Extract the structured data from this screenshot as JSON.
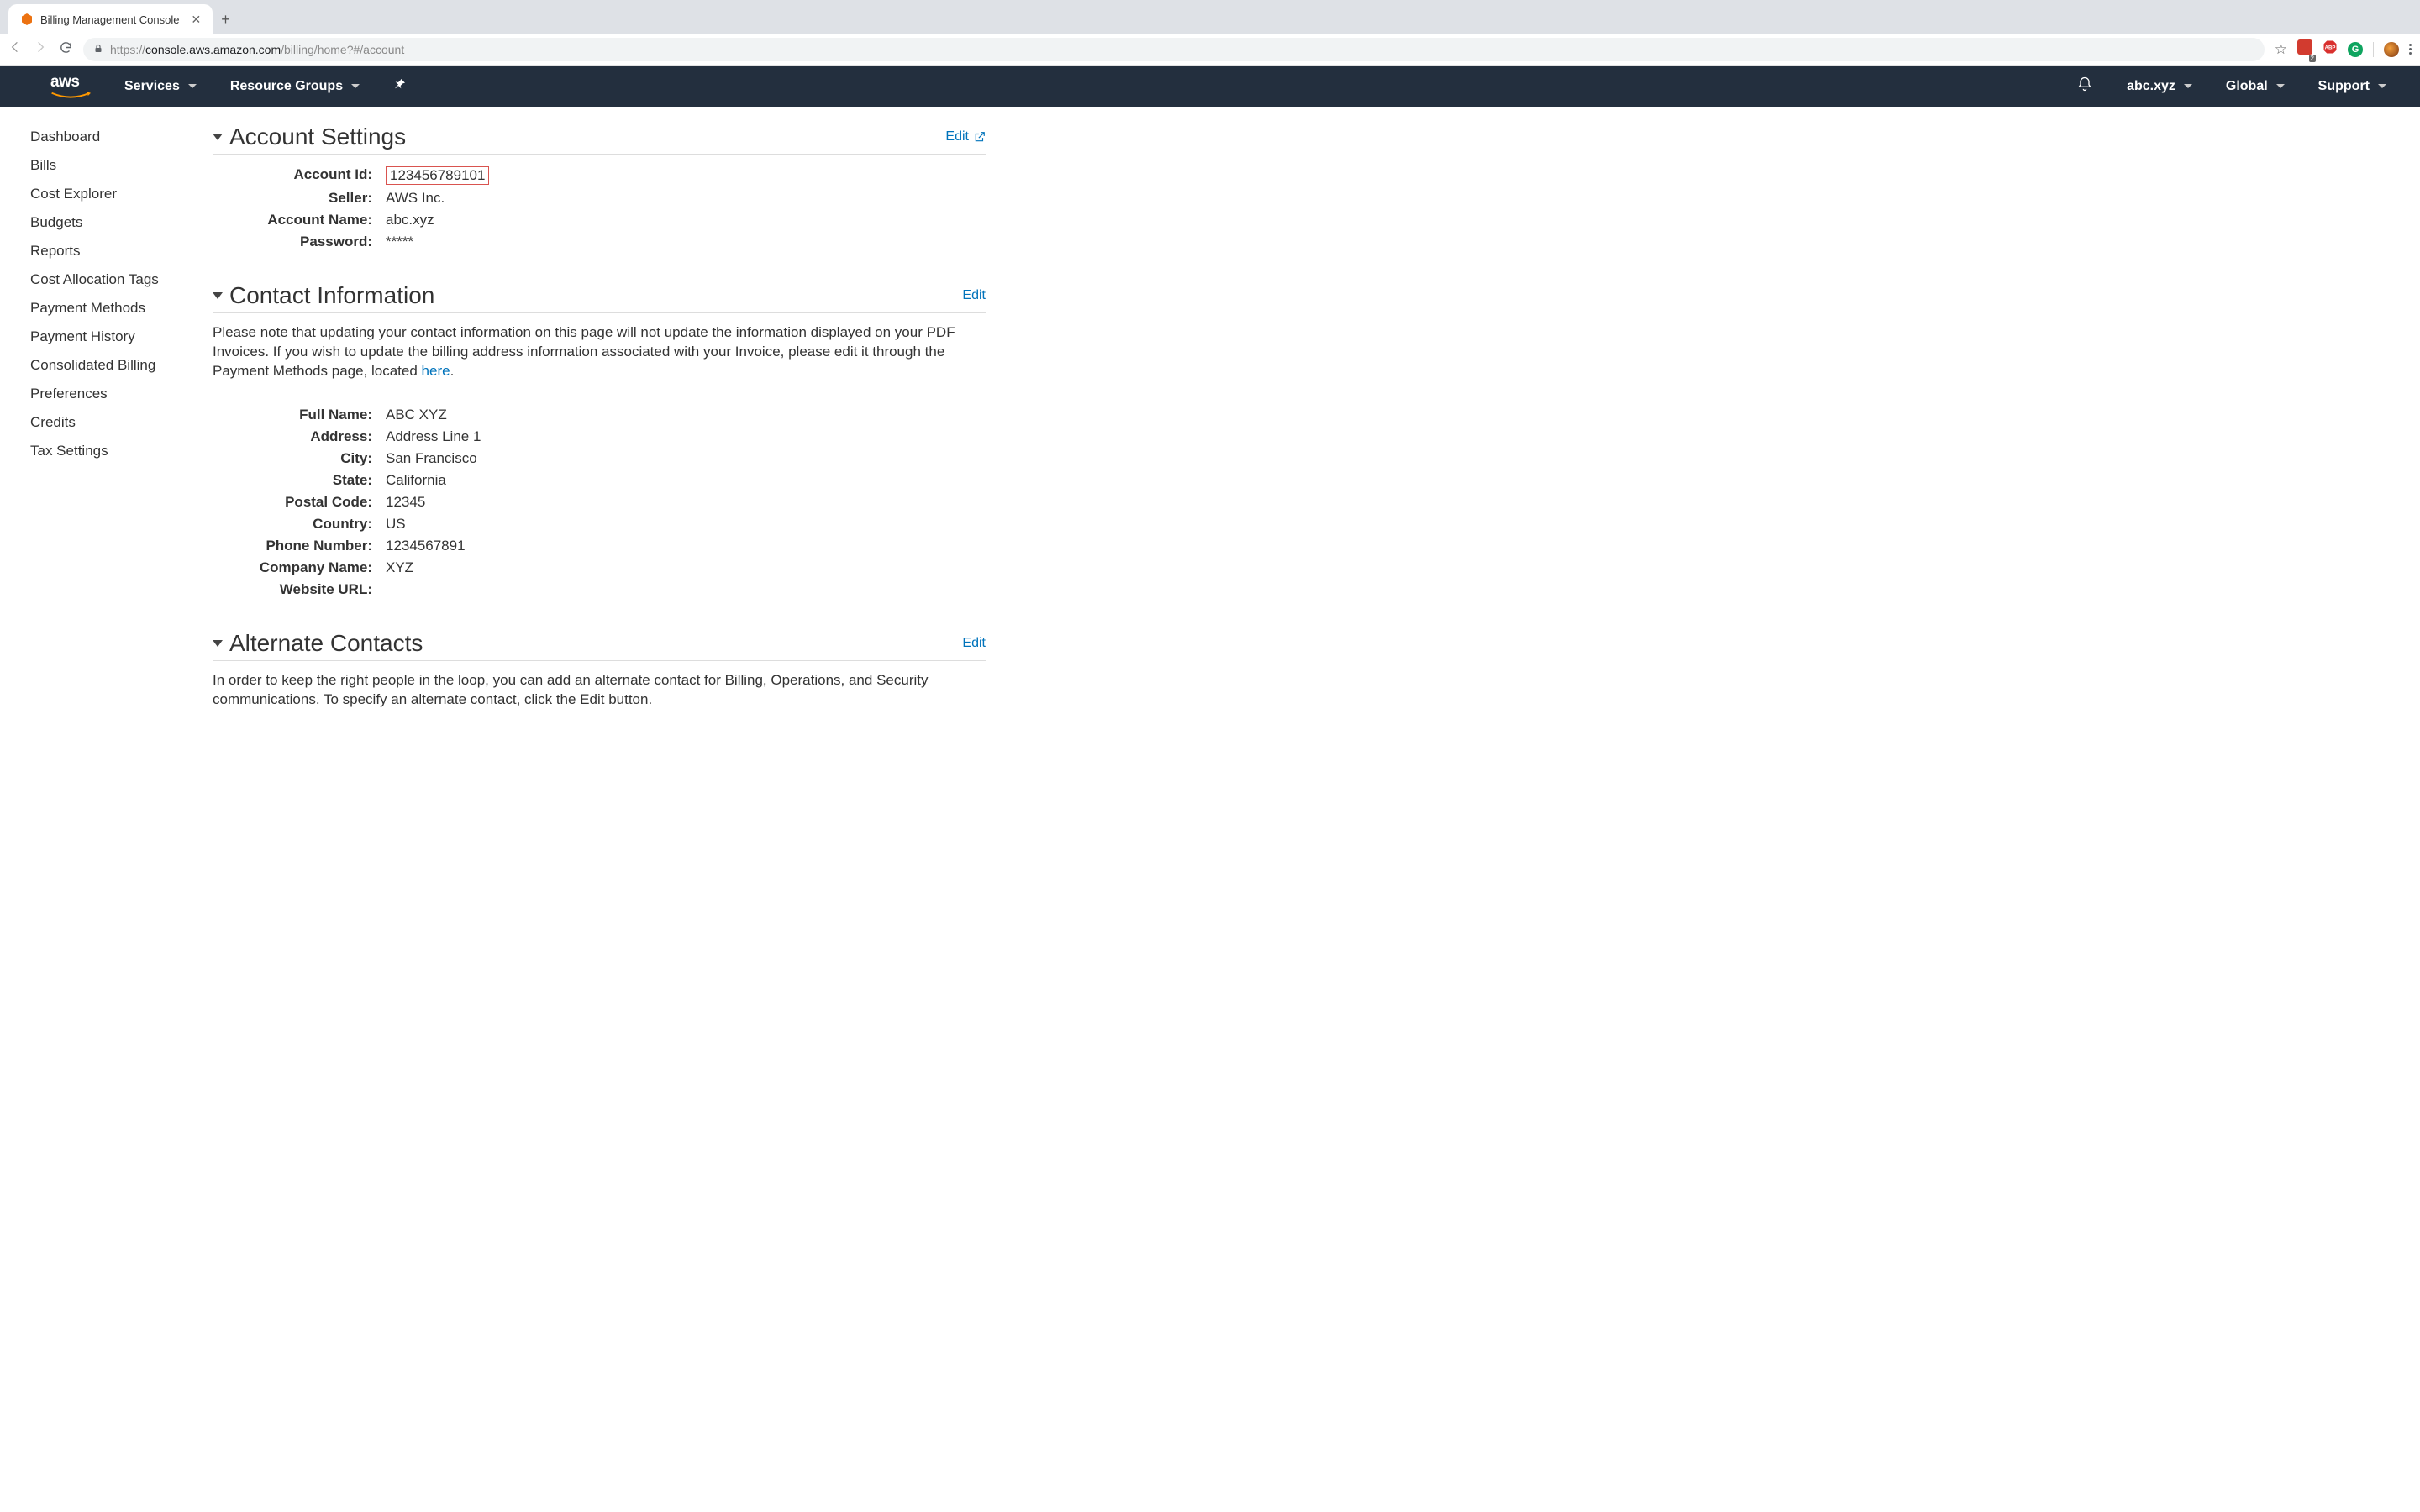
{
  "browser": {
    "tab_title": "Billing Management Console",
    "url_scheme": "https://",
    "url_host": "console.aws.amazon.com",
    "url_path": "/billing/home?#/account",
    "ext_badge1": "",
    "ext_badge1_count": "2",
    "ext_badge2": "ABP",
    "ext_badge3": "G"
  },
  "header": {
    "logo": "aws",
    "services": "Services",
    "resource_groups": "Resource Groups",
    "user": "abc.xyz",
    "region": "Global",
    "support": "Support"
  },
  "sidebar": {
    "items": [
      "Dashboard",
      "Bills",
      "Cost Explorer",
      "Budgets",
      "Reports",
      "Cost Allocation Tags",
      "Payment Methods",
      "Payment History",
      "Consolidated Billing",
      "Preferences",
      "Credits",
      "Tax Settings"
    ]
  },
  "sections": {
    "account": {
      "title": "Account Settings",
      "edit": "Edit",
      "fields": {
        "account_id_label": "Account Id:",
        "account_id_value": "123456789101",
        "seller_label": "Seller:",
        "seller_value": "AWS Inc.",
        "account_name_label": "Account Name:",
        "account_name_value": "abc.xyz",
        "password_label": "Password:",
        "password_value": "*****"
      }
    },
    "contact": {
      "title": "Contact Information",
      "edit": "Edit",
      "note_pre": "Please note that updating your contact information on this page will not update the information displayed on your PDF Invoices. If you wish to update the billing address information associated with your Invoice, please edit it through the Payment Methods page, located ",
      "note_link": "here",
      "note_post": ".",
      "fields": {
        "full_name_label": "Full Name:",
        "full_name_value": "ABC XYZ",
        "address_label": "Address:",
        "address_value": "Address Line 1",
        "city_label": "City:",
        "city_value": "San Francisco",
        "state_label": "State:",
        "state_value": "California",
        "postal_label": "Postal Code:",
        "postal_value": "12345",
        "country_label": "Country:",
        "country_value": "US",
        "phone_label": "Phone Number:",
        "phone_value": "1234567891",
        "company_label": "Company Name:",
        "company_value": "XYZ",
        "website_label": "Website URL:",
        "website_value": ""
      }
    },
    "alternate": {
      "title": "Alternate Contacts",
      "edit": "Edit",
      "note": "In order to keep the right people in the loop, you can add an alternate contact for Billing, Operations, and Security communications. To specify an alternate contact, click the Edit button."
    }
  }
}
